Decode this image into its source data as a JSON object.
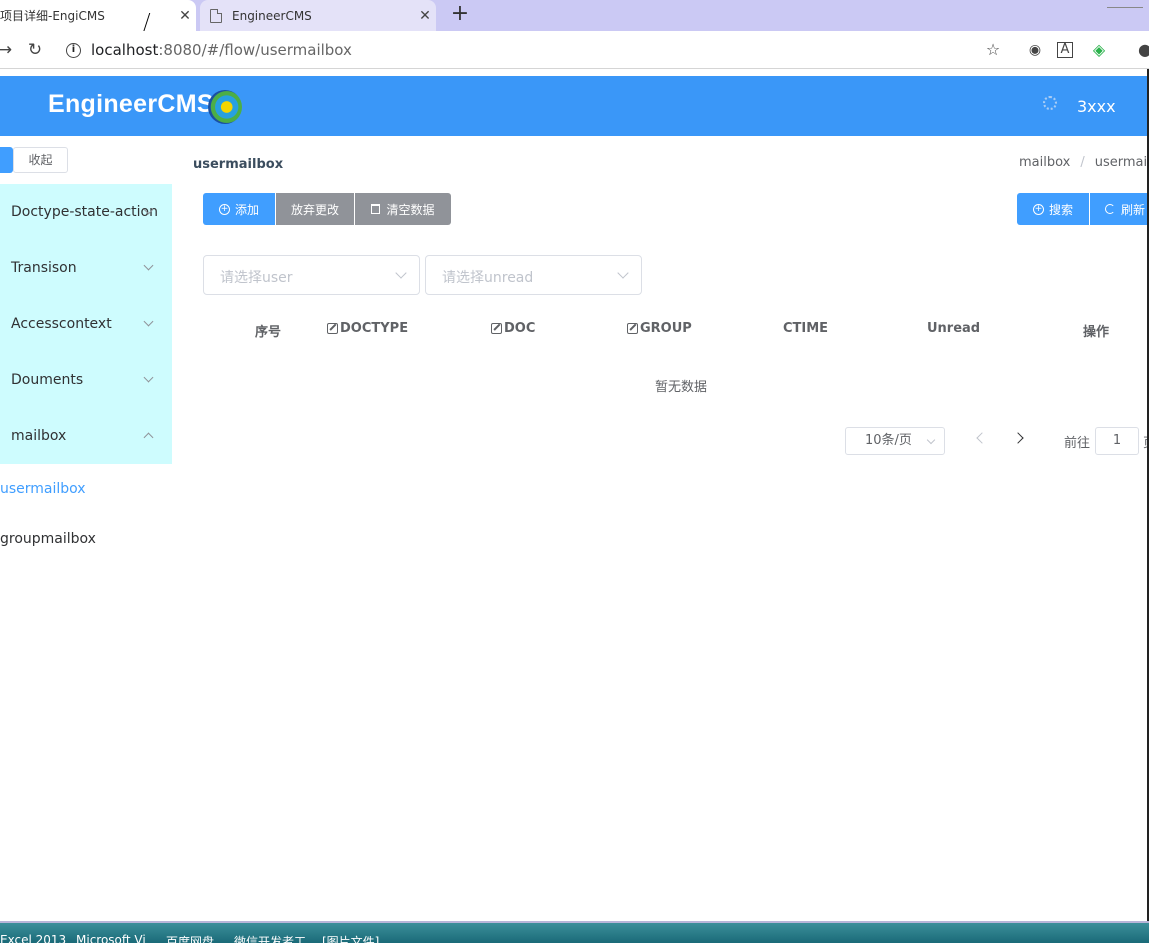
{
  "browser": {
    "tabs": [
      {
        "title": "项目详细-EngiCMS",
        "close": "✕"
      },
      {
        "title": "EngineerCMS",
        "close": "✕"
      }
    ],
    "new_tab": "+",
    "url_host": "localhost",
    "url_path": ":8080/#/flow/usermailbox"
  },
  "header": {
    "brand": "EngineerCMS",
    "user": "3xxx"
  },
  "sidebar": {
    "collapse_label": "收起",
    "menus": [
      {
        "label": "Doctype-state-action",
        "expanded": false
      },
      {
        "label": "Transison",
        "expanded": false
      },
      {
        "label": "Accesscontext",
        "expanded": false
      },
      {
        "label": "Douments",
        "expanded": false
      },
      {
        "label": "mailbox",
        "expanded": true
      }
    ],
    "submenu": [
      {
        "label": "usermailbox",
        "active": true
      },
      {
        "label": "groupmailbox",
        "active": false
      }
    ]
  },
  "main": {
    "title": "usermailbox",
    "breadcrumb": [
      "mailbox",
      "usermailbox"
    ],
    "toolbar": {
      "add": "添加",
      "discard": "放弃更改",
      "clear": "清空数据",
      "search": "搜索",
      "refresh": "刷新"
    },
    "filters": {
      "user_placeholder": "请选择user",
      "unread_placeholder": "请选择unread"
    },
    "table": {
      "columns": [
        "序号",
        "DOCTYPE",
        "DOC",
        "GROUP",
        "CTIME",
        "Unread",
        "操作"
      ],
      "empty_text": "暂无数据"
    },
    "pagination": {
      "page_size": "10条/页",
      "goto_label": "前往",
      "current_page": "1",
      "unit": "页"
    }
  },
  "taskbar": {
    "items": [
      "Excel 2013",
      "Microsoft Vi",
      "百度网盘",
      "微信开发者工",
      "[图片文件]"
    ]
  },
  "colors": {
    "primary": "#409eff",
    "header_bg": "#3a97f8",
    "sidebar_bg": "#cefcfe",
    "secondary_button": "#909399"
  }
}
